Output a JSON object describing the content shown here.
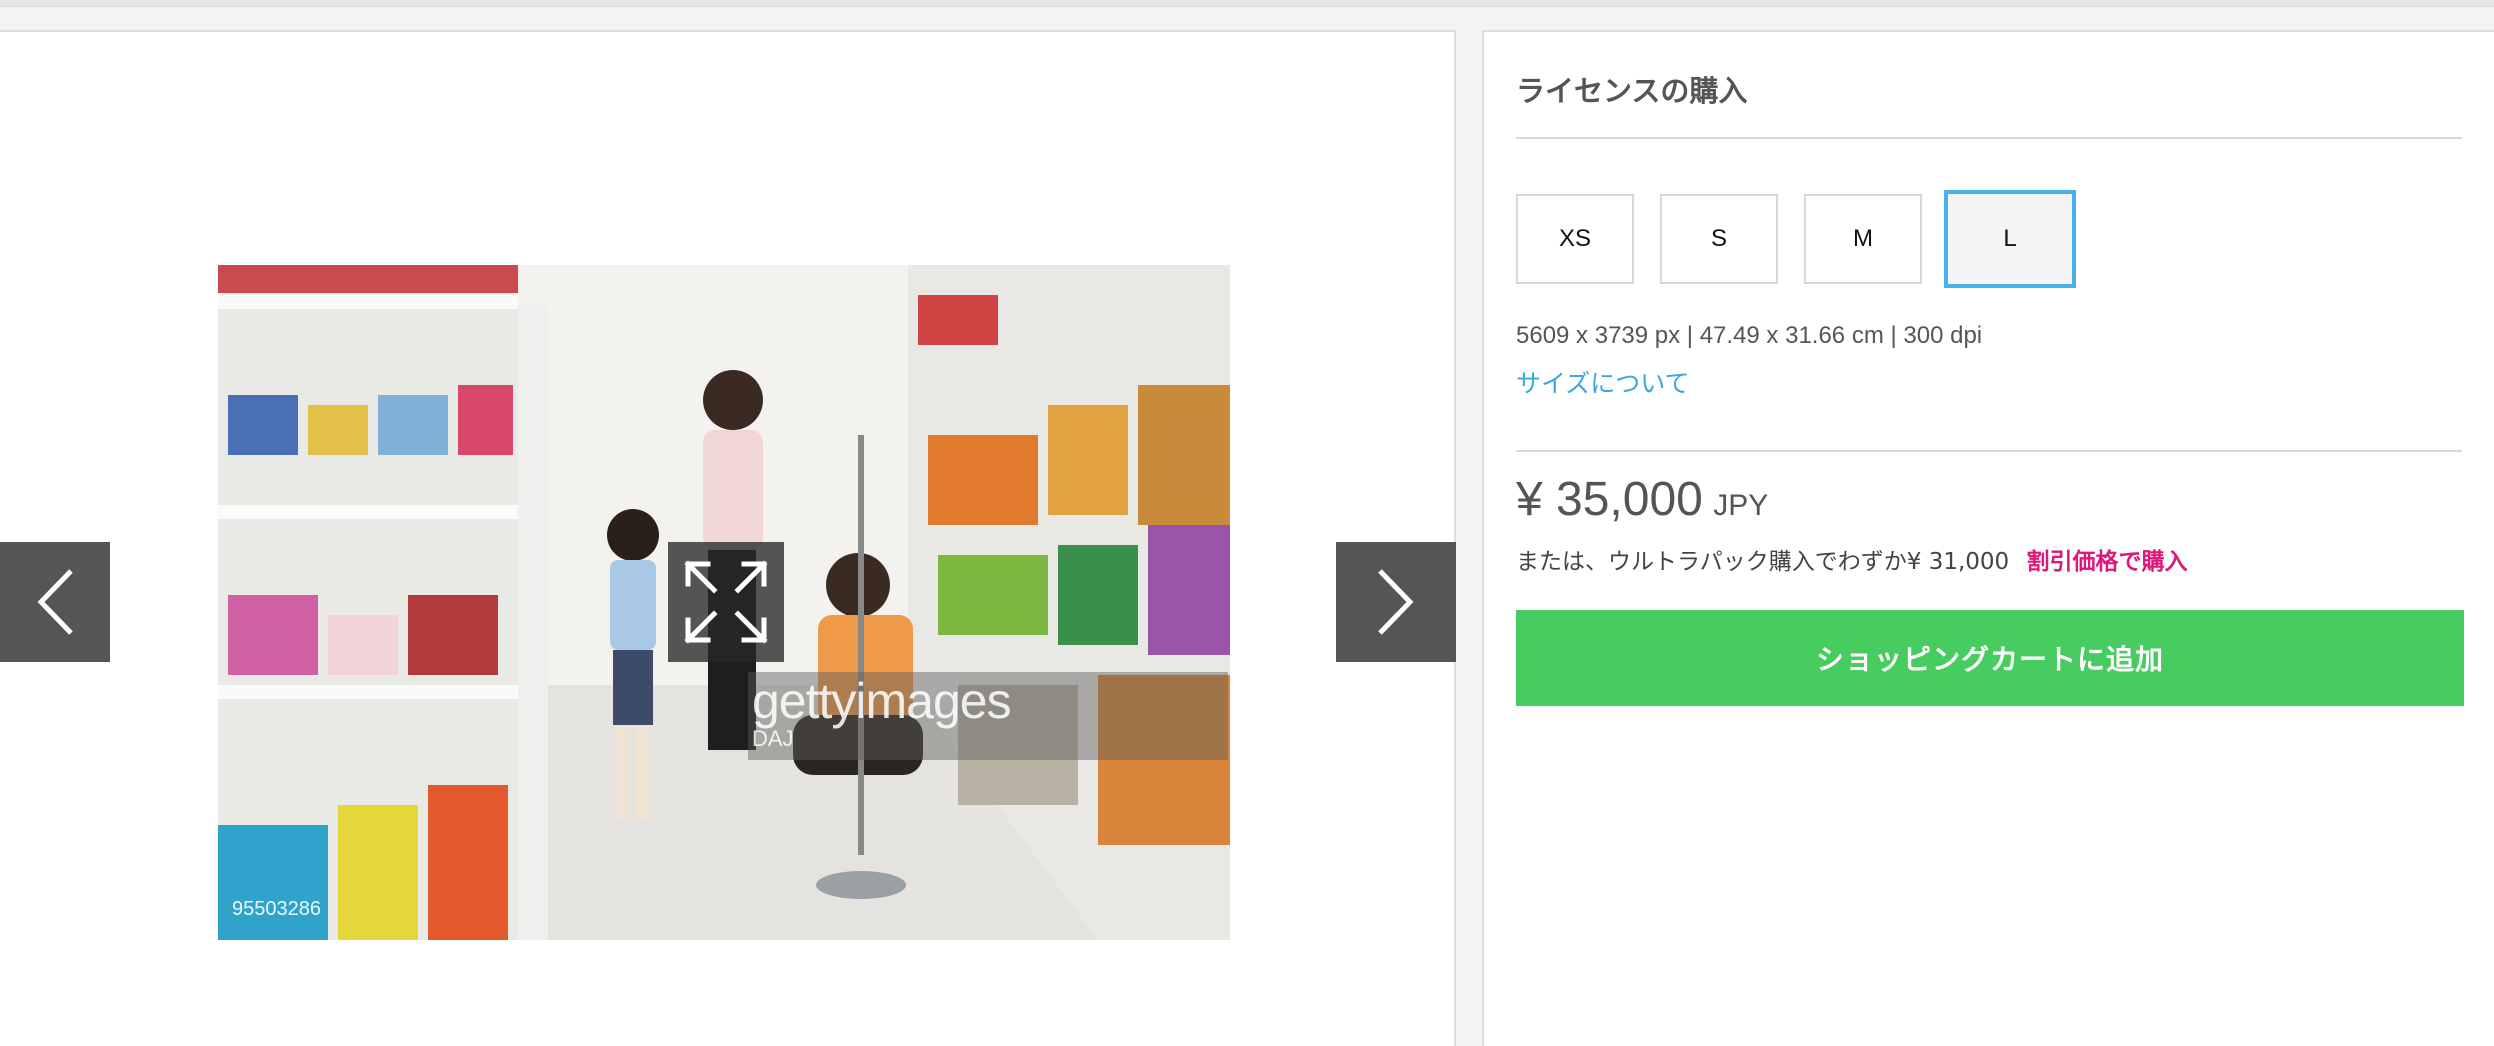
{
  "image": {
    "watermark_brand": "gettyimages",
    "watermark_sub": "DAJ",
    "image_id": "95503286"
  },
  "license": {
    "title": "ライセンスの購入",
    "sizes": [
      {
        "label": "XS",
        "selected": false
      },
      {
        "label": "S",
        "selected": false
      },
      {
        "label": "M",
        "selected": false
      },
      {
        "label": "L",
        "selected": true
      }
    ],
    "spec": "5609 x 3739 px | 47.49 x 31.66 cm | 300 dpi",
    "size_link": "サイズについて",
    "price_amount": "¥ 35,000",
    "price_currency": "JPY",
    "ultra_text": "または、ウルトラパック購入でわずか¥ 31,000",
    "ultra_link": "割引価格で購入",
    "cart_button": "ショッピングカートに追加"
  },
  "colors": {
    "accent_blue": "#49b1e8",
    "cart_green": "#47cc5f",
    "discount_pink": "#e0177b",
    "nav_gray": "#555555"
  },
  "icons": {
    "prev": "chevron-left-icon",
    "next": "chevron-right-icon",
    "expand": "expand-icon"
  }
}
